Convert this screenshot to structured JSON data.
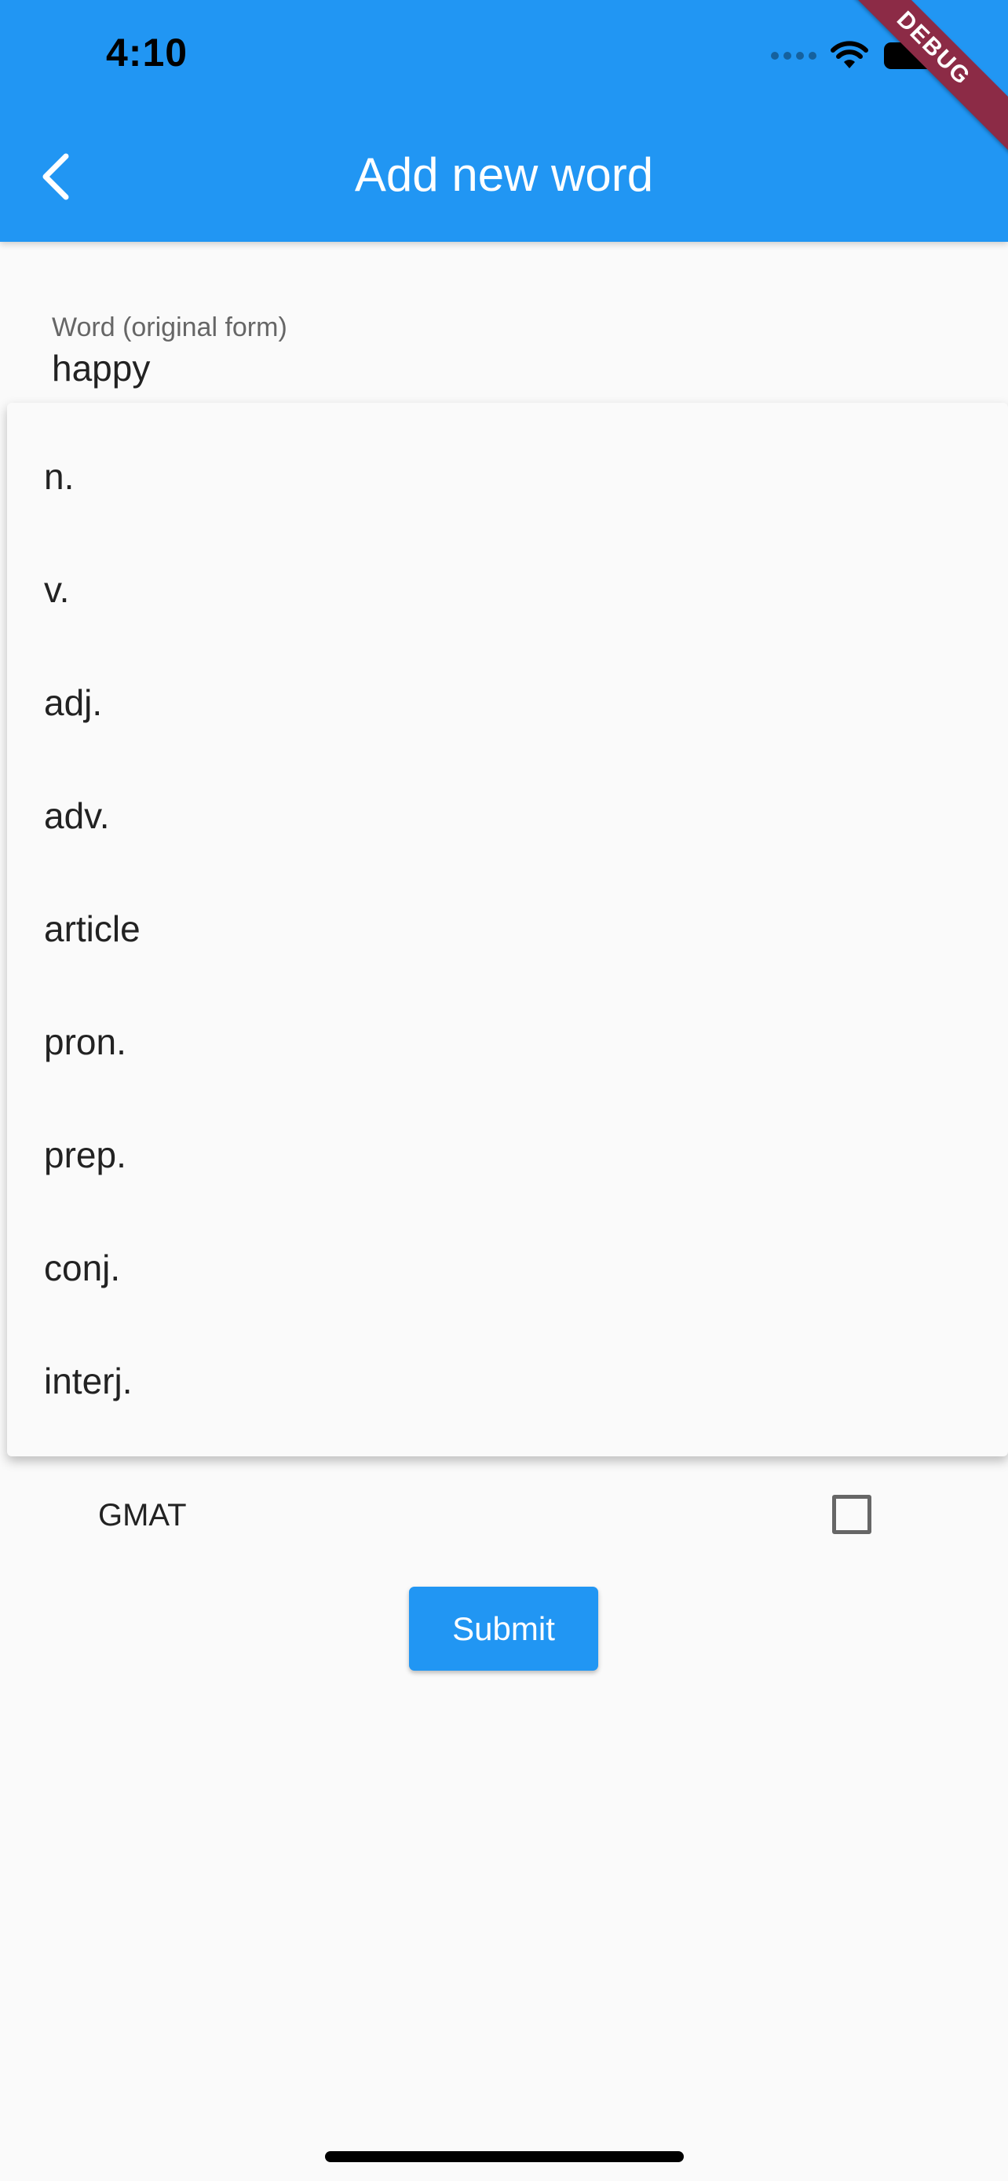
{
  "status_bar": {
    "time": "4:10"
  },
  "app_bar": {
    "title": "Add new word",
    "back_icon": "chevron-left-icon",
    "background_color": "#2196f3"
  },
  "debug_banner": {
    "text": "DEBUG",
    "color": "#8c2b46"
  },
  "word_field": {
    "label": "Word (original form)",
    "value": "happy"
  },
  "part_of_speech_dropdown": {
    "options": [
      "n.",
      "v.",
      "adj.",
      "adv.",
      "article",
      "pron.",
      "prep.",
      "conj.",
      "interj."
    ]
  },
  "checkbox_row": {
    "label": "GMAT",
    "checked": false
  },
  "submit": {
    "label": "Submit",
    "color": "#2196f3"
  }
}
